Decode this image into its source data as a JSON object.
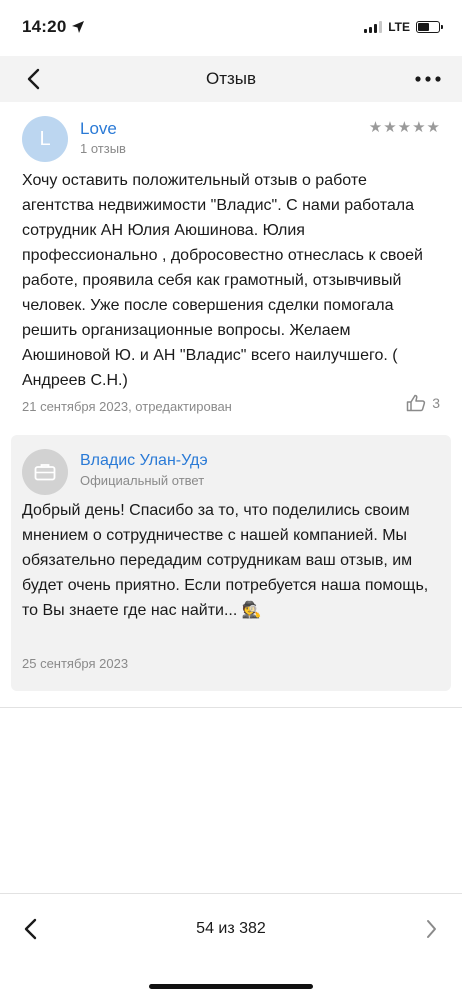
{
  "status_bar": {
    "time": "14:20",
    "network": "LTE"
  },
  "nav": {
    "title": "Отзыв"
  },
  "review": {
    "avatar_letter": "L",
    "author": "Love",
    "author_meta": "1 отзыв",
    "rating": 5,
    "text": "Хочу оставить положительный отзыв о работе агентства недвижимости \"Владис\". С нами работала сотрудник АН Юлия Аюшинова. Юлия профессионально , добросовестно отнеслась к своей работе, проявила себя как грамотный, отзывчивый человек. Уже после совершения сделки помогала решить организационные вопросы. Желаем Аюшиновой Ю. и АН \"Владис\" всего наилучшего.  ( Андреев С.Н.)",
    "date": "21 сентября 2023, отредактирован",
    "likes": "3"
  },
  "reply": {
    "author": "Владис Улан-Удэ",
    "author_meta": "Официальный ответ",
    "text": "Добрый день! Спасибо за то, что поделились своим мнением о сотрудничестве с нашей компанией. Мы обязательно передадим сотрудникам ваш отзыв, им будет очень приятно. Если потребуется наша помощь, то Вы знаете где нас найти... 🕵",
    "date": "25 сентября 2023"
  },
  "pager": {
    "text": "54 из 382"
  },
  "colors": {
    "link": "#2a7ad6",
    "muted": "#8a8a8a",
    "nav_bg": "#f3f3f3",
    "reply_bg": "#f2f2f2"
  }
}
